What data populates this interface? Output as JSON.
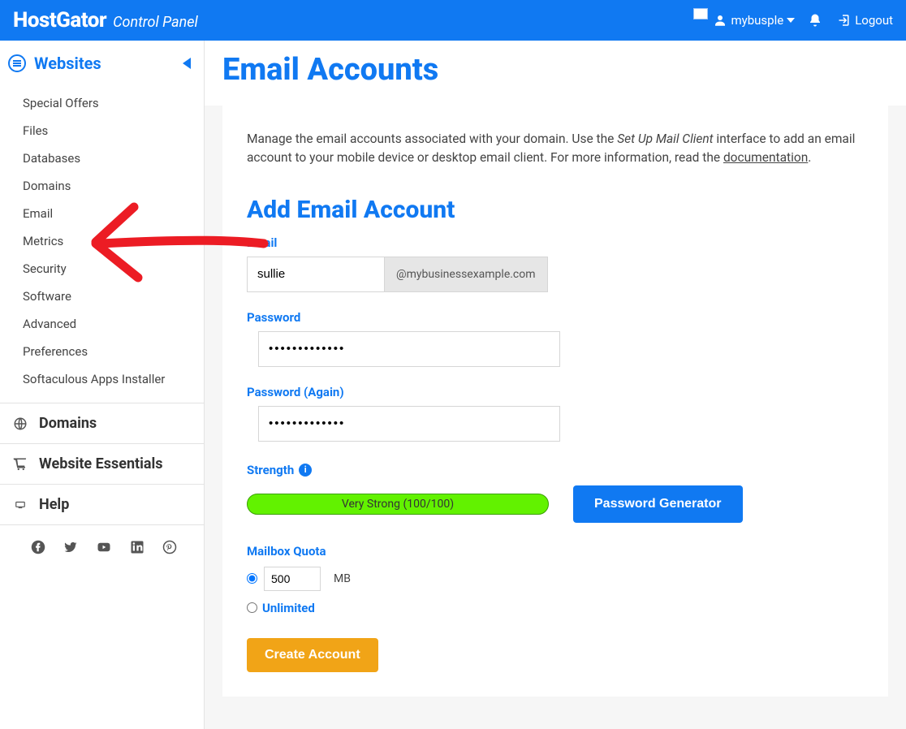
{
  "header": {
    "logo": "HostGator",
    "subtitle": "Control Panel",
    "username": "mybusple",
    "logout_label": "Logout"
  },
  "sidebar": {
    "title": "Websites",
    "items": [
      "Special Offers",
      "Files",
      "Databases",
      "Domains",
      "Email",
      "Metrics",
      "Security",
      "Software",
      "Advanced",
      "Preferences",
      "Softaculous Apps Installer"
    ],
    "sections": [
      "Domains",
      "Website Essentials",
      "Help"
    ]
  },
  "page": {
    "title": "Email Accounts",
    "intro_pre": "Manage the email accounts associated with your domain. Use the ",
    "intro_italic": "Set Up Mail Client",
    "intro_mid": " interface to add an email account to your mobile device or desktop email client. For more information, read the ",
    "intro_link": "documentation",
    "intro_post": "."
  },
  "form": {
    "section_title": "Add Email Account",
    "email_label": "Email",
    "email_value": "sullie",
    "email_domain": "@mybusinessexample.com",
    "password_label": "Password",
    "password_value": "•••••••••••••",
    "password2_label": "Password (Again)",
    "password2_value": "•••••••••••••",
    "strength_label": "Strength",
    "strength_text": "Very Strong (100/100)",
    "pwd_gen_label": "Password Generator",
    "quota_label": "Mailbox Quota",
    "quota_value": "500",
    "quota_unit": "MB",
    "unlimited_label": "Unlimited",
    "create_label": "Create Account"
  },
  "colors": {
    "brand": "#1079f2",
    "accent": "#f1a417",
    "strength_bar": "#62f200"
  }
}
